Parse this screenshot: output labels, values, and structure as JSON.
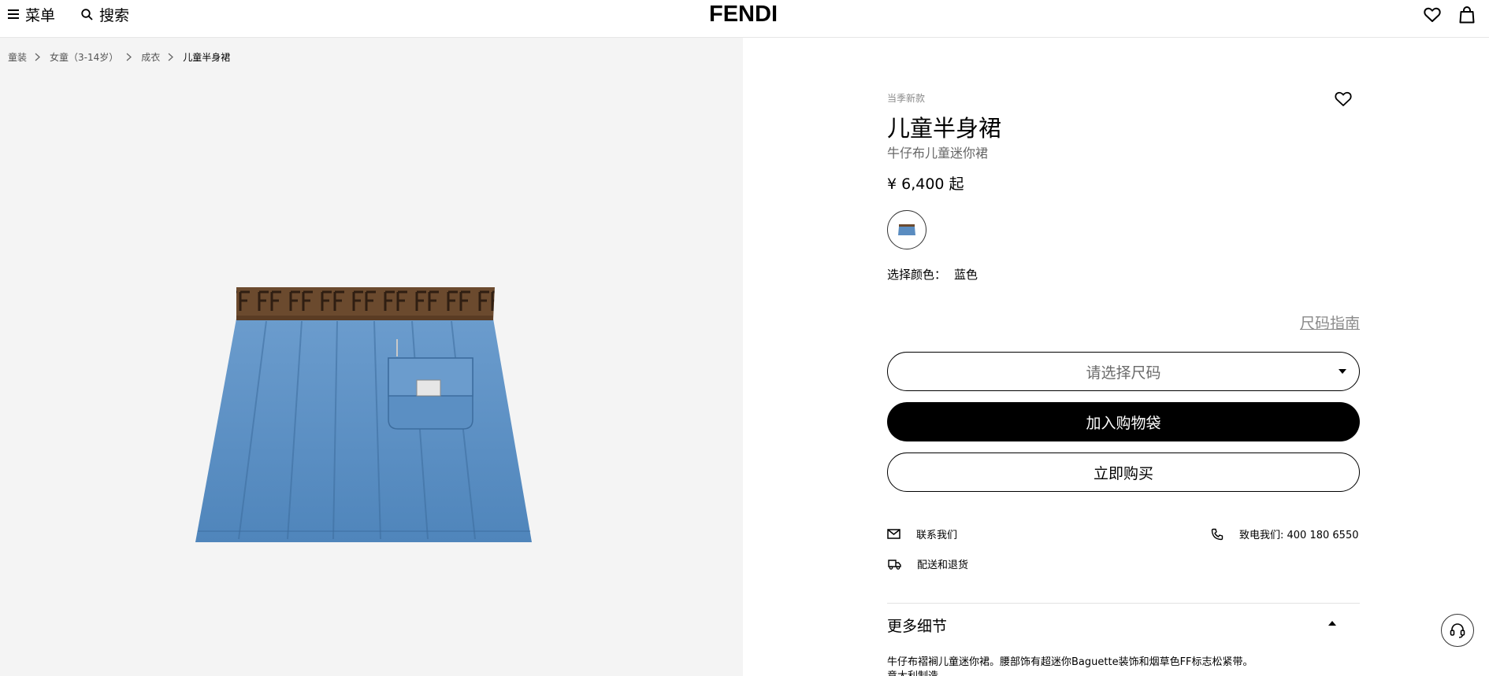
{
  "header": {
    "menu_label": "菜单",
    "search_label": "搜索",
    "logo": "FENDI"
  },
  "breadcrumb": [
    "童装",
    "女童（3-14岁）",
    "成衣",
    "儿童半身裙"
  ],
  "product": {
    "tag": "当季新款",
    "title": "儿童半身裙",
    "subtitle": "牛仔布儿童迷你裙",
    "price": "¥ 6,400 起",
    "color_label": "选择颜色：",
    "color_value": "蓝色",
    "size_guide": "尺码指南",
    "size_placeholder": "请选择尺码",
    "add_to_bag": "加入购物袋",
    "buy_now": "立即购买",
    "contact_label": "联系我们",
    "phone_label": "致电我们: 400 180 6550",
    "delivery_label": "配送和退货",
    "details_label": "更多细节",
    "details_text": "牛仔布褶裥儿童迷你裙。腰部饰有超迷你Baguette装饰和烟草色FF标志松紧带。",
    "details_text_2": "意大利制造"
  },
  "colors": {
    "denim": "#5a8cc0",
    "waistband": "#6b4a2e",
    "gallery_bg": "#f4f4f4"
  },
  "icons": {
    "menu": "hamburger-icon",
    "search": "search-icon",
    "wishlist": "heart-icon",
    "bag": "shopping-bag-icon",
    "mail": "mail-icon",
    "phone": "phone-icon",
    "truck": "delivery-truck-icon",
    "support": "headset-icon"
  }
}
